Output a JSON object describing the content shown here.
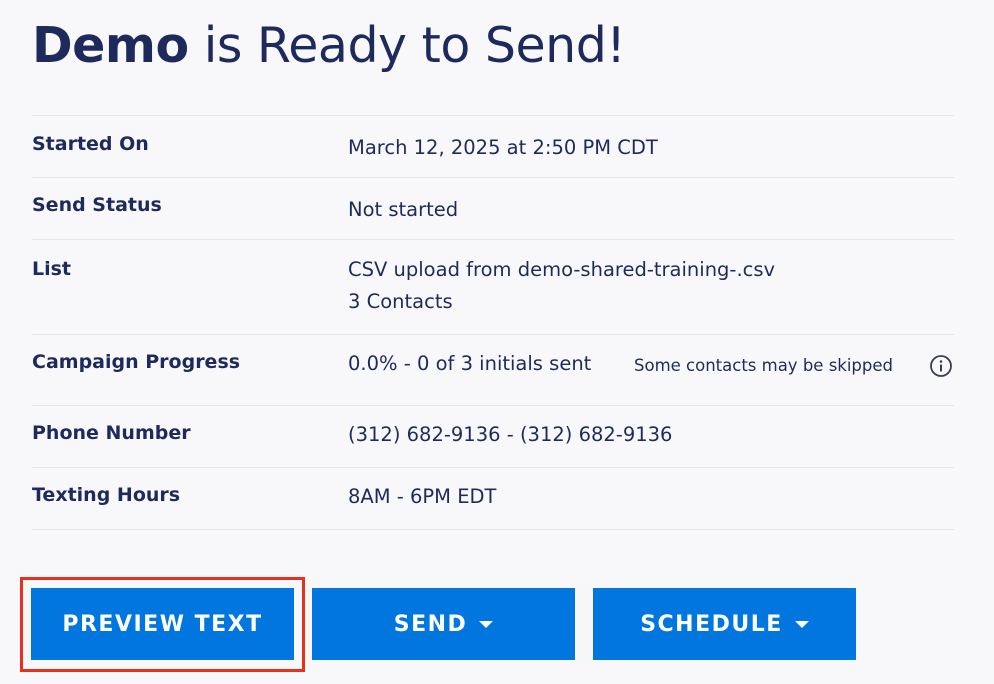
{
  "header": {
    "campaign_name": "Demo",
    "title_suffix": " is Ready to Send!"
  },
  "details": {
    "started_on": {
      "label": "Started On",
      "value": "March 12, 2025 at 2:50 PM CDT"
    },
    "send_status": {
      "label": "Send Status",
      "value": "Not started"
    },
    "list": {
      "label": "List",
      "value_line1": "CSV upload from demo-shared-training-.csv",
      "value_line2": "3 Contacts"
    },
    "campaign_progress": {
      "label": "Campaign Progress",
      "value": "0.0% - 0 of 3 initials sent",
      "note": "Some contacts may be skipped",
      "progress_percent": 0.0
    },
    "phone_number": {
      "label": "Phone Number",
      "value": "(312) 682-9136 - (312) 682-9136"
    },
    "texting_hours": {
      "label": "Texting Hours",
      "value": "8AM - 6PM EDT"
    }
  },
  "actions": {
    "preview_label": "PREVIEW TEXT",
    "send_label": "SEND",
    "schedule_label": "SCHEDULE"
  },
  "icons": {
    "info": "info-icon",
    "caret": "chevron-down-icon"
  },
  "colors": {
    "primary_button": "#0076de",
    "text": "#1f2a5c",
    "highlight": "#e5321f",
    "background": "#f8f8fb"
  }
}
